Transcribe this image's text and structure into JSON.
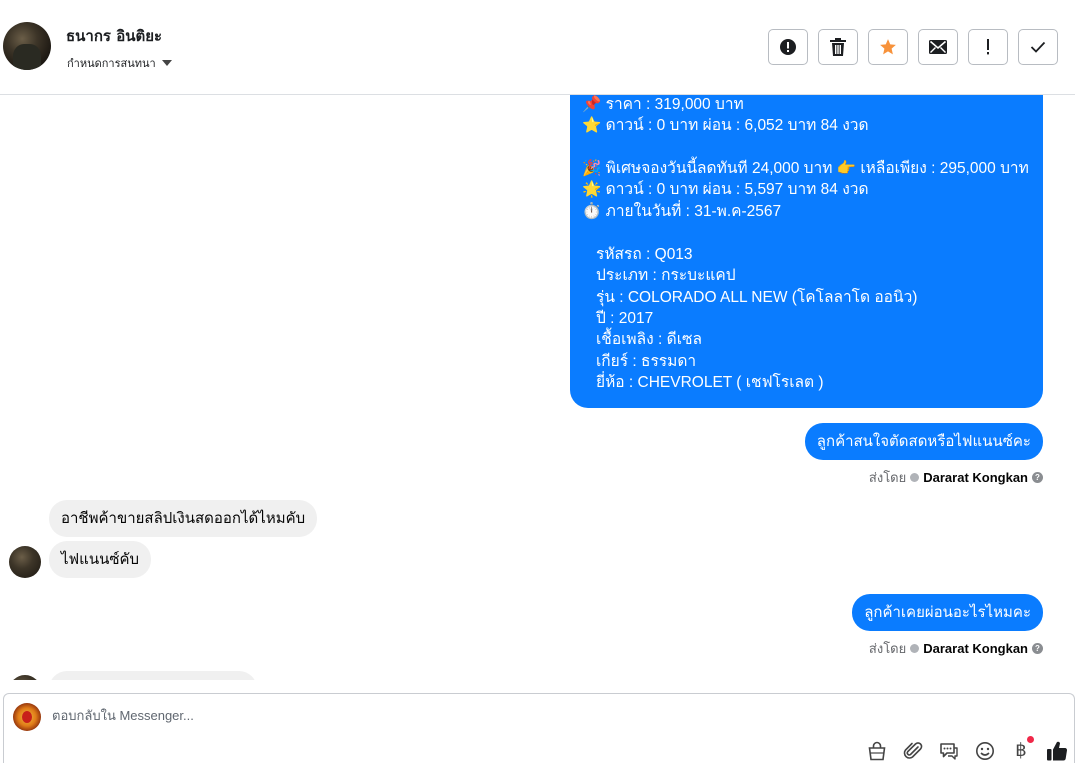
{
  "header": {
    "contact_name": "ธนากร อินติยะ",
    "assign_label": "กำหนดการสนทนา",
    "toolbar": [
      {
        "name": "spam-button",
        "icon": "alert-circle-icon"
      },
      {
        "name": "delete-button",
        "icon": "trash-icon"
      },
      {
        "name": "star-button",
        "icon": "star-icon",
        "color": "#f7923b"
      },
      {
        "name": "mark-unread-button",
        "icon": "envelope-icon"
      },
      {
        "name": "follow-up-button",
        "icon": "exclamation-icon"
      },
      {
        "name": "mark-done-button",
        "icon": "checkmark-icon"
      }
    ]
  },
  "messages": {
    "listing_lines": [
      {
        "emoji": "📌",
        "text": "ราคา : 319,000 บาท"
      },
      {
        "emoji": "⭐",
        "text": "ดาวน์ : 0 บาท ผ่อน : 6,052 บาท 84 งวด"
      },
      {
        "emoji": "🎉",
        "text": "พิเศษจองวันนี้ลดทันที 24,000 บาท 👉 เหลือเพียง : 295,000 บาท"
      },
      {
        "emoji": "🌟",
        "text": "ดาวน์ : 0 บาท ผ่อน : 5,597 บาท 84 งวด"
      },
      {
        "emoji": "⏱️",
        "text": "ภายในวันที่ : 31-พ.ค-2567"
      },
      {
        "emoji": "",
        "text": "รหัสรถ : Q013"
      },
      {
        "emoji": "",
        "text": "ประเภท : กระบะแคป"
      },
      {
        "emoji": "",
        "text": "รุ่น : COLORADO ALL NEW (โคโลลาโด ออนิว)"
      },
      {
        "emoji": "",
        "text": "ปี : 2017"
      },
      {
        "emoji": "",
        "text": "เชื้อเพลิง : ดีเซล"
      },
      {
        "emoji": "",
        "text": "เกียร์ : ธรรมดา"
      },
      {
        "emoji": "",
        "text": "ยี่ห้อ : CHEVROLET ( เชฟโรเลต )"
      }
    ],
    "out_1": "ลูกค้าสนใจตัดสดหรือไฟแนนซ์คะ",
    "sent_by_label": "ส่งโดย",
    "sender_name": "Dararat Kongkan",
    "in_1": "อาชีพค้าขายสลิปเงินสดออกได้ไหมคับ",
    "in_2": "ไฟแนนซ์คับ",
    "out_2": "ลูกค้าเคยผ่อนอะไรไหมคะ"
  },
  "composer": {
    "placeholder": "ตอบกลับใน Messenger...",
    "tools": [
      "bag-icon",
      "paperclip-icon",
      "chat-bubbles-icon",
      "smiley-icon",
      "baht-icon",
      "thumbs-up-icon"
    ],
    "baht_symbol": "฿"
  }
}
